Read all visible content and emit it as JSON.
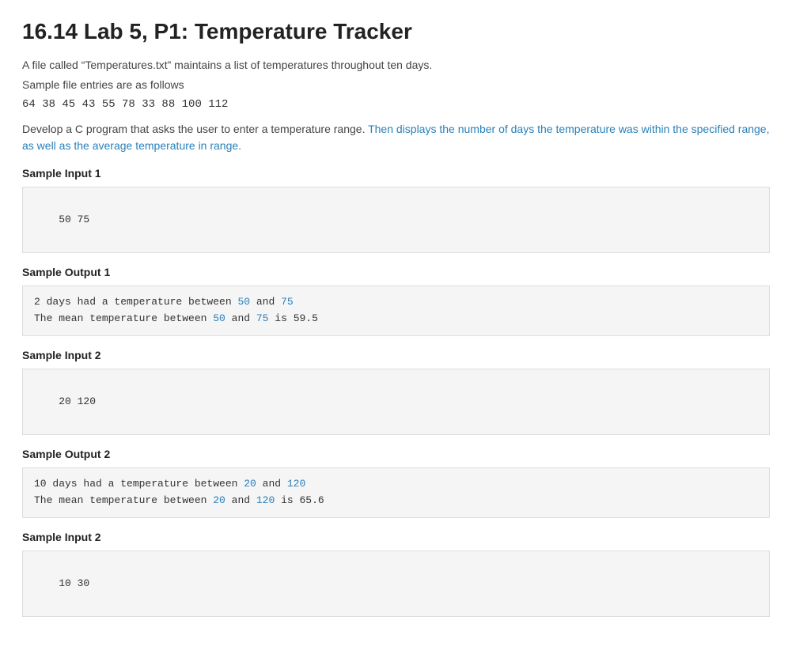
{
  "page": {
    "title": "16.14 Lab 5, P1: Temperature Tracker",
    "intro_paragraph": "A file called “Temperatures.txt” maintains a list of temperatures throughout ten days.",
    "sample_file_label": "Sample file entries are as follows",
    "sample_file_entries": "64 38 45 43 55 78 33 88 ",
    "sample_file_entries_red": "100 112",
    "description_part1": "Develop a C program that asks the user to enter a temperature range. ",
    "description_part2": "Then displays the number of days the temperature was within the specified range, as well as the average temperature in range.",
    "sections": [
      {
        "input_label": "Sample Input 1",
        "input_value": "50 75",
        "output_label": "Sample Output 1",
        "output_lines": [
          {
            "prefix": "2 days had a temperature between ",
            "blue1": "50",
            "mid": " and ",
            "blue2": "75",
            "suffix": ""
          },
          {
            "prefix": "The mean temperature between ",
            "blue1": "50",
            "mid": " and ",
            "blue2": "75",
            "suffix": " is 59.5"
          }
        ]
      },
      {
        "input_label": "Sample Input 2",
        "input_value": "20 120",
        "output_label": "Sample Output 2",
        "output_lines": [
          {
            "prefix": "10 days had a temperature between ",
            "blue1": "20",
            "mid": " and ",
            "blue2": "120",
            "suffix": ""
          },
          {
            "prefix": "The mean temperature between ",
            "blue1": "20",
            "mid": " and ",
            "blue2": "120",
            "suffix": " is 65.6"
          }
        ]
      },
      {
        "input_label": "Sample Input 2",
        "input_value": "10 30",
        "output_label": null,
        "output_lines": []
      }
    ]
  }
}
